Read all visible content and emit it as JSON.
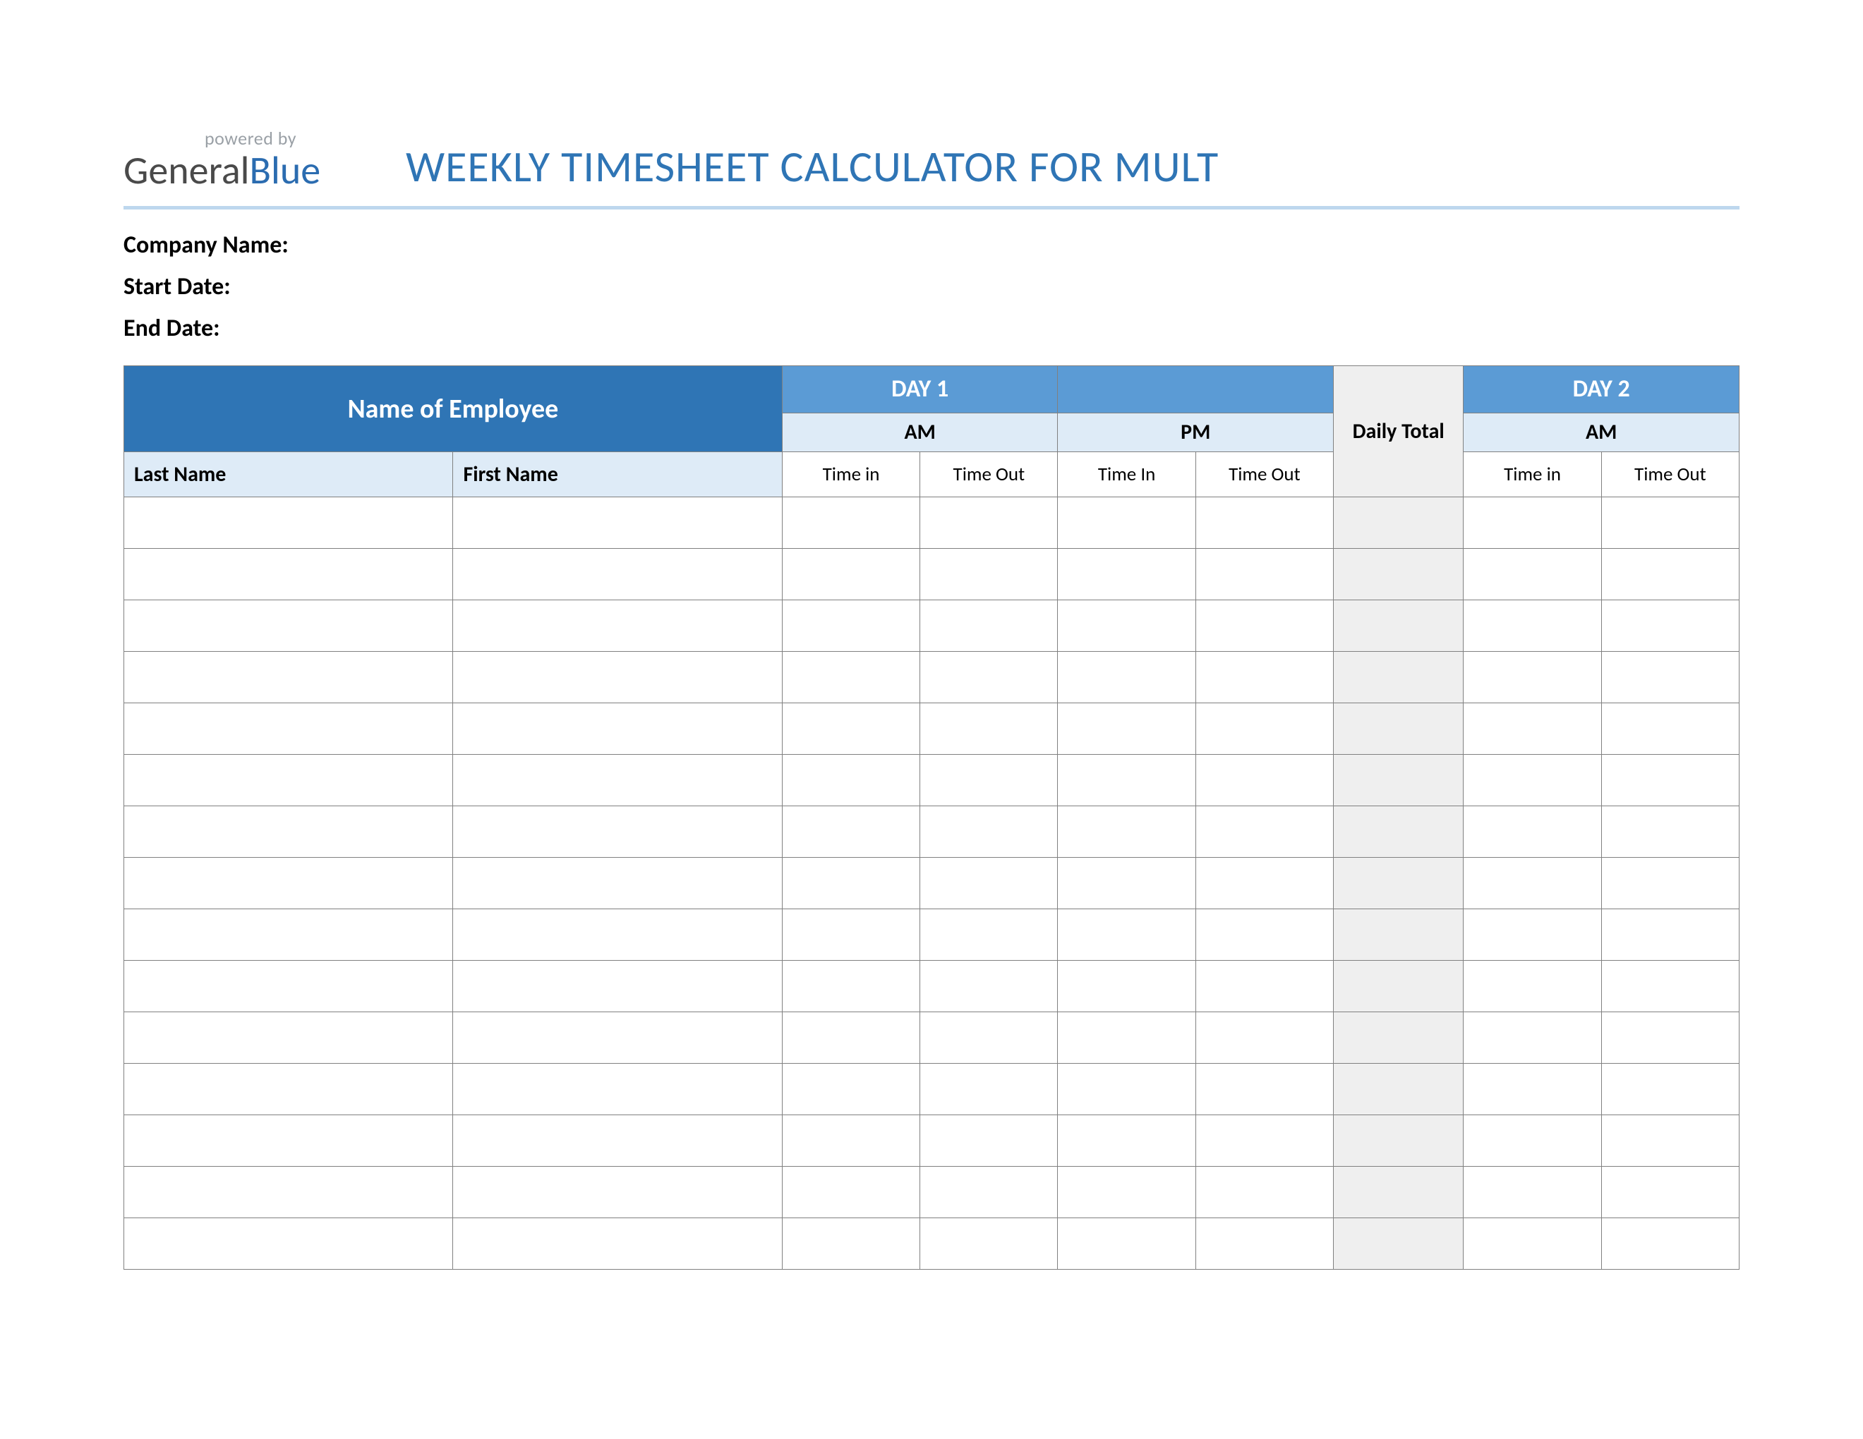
{
  "branding": {
    "powered_by": "powered by",
    "logo_general": "General",
    "logo_blue": "Blue"
  },
  "title": "WEEKLY TIMESHEET CALCULATOR FOR MULT",
  "fields": {
    "company": "Company Name:",
    "start_date": "Start Date:",
    "end_date": "End Date:"
  },
  "table": {
    "name_of_employee": "Name of Employee",
    "day1": "DAY 1",
    "day_blank": "",
    "day2": "DAY 2",
    "am": "AM",
    "pm": "PM",
    "daily_total": "Daily Total",
    "last_name": "Last Name",
    "first_name": "First Name",
    "time_in": "Time in",
    "time_in_cap": "Time In",
    "time_out": "Time Out"
  },
  "row_count": 15
}
